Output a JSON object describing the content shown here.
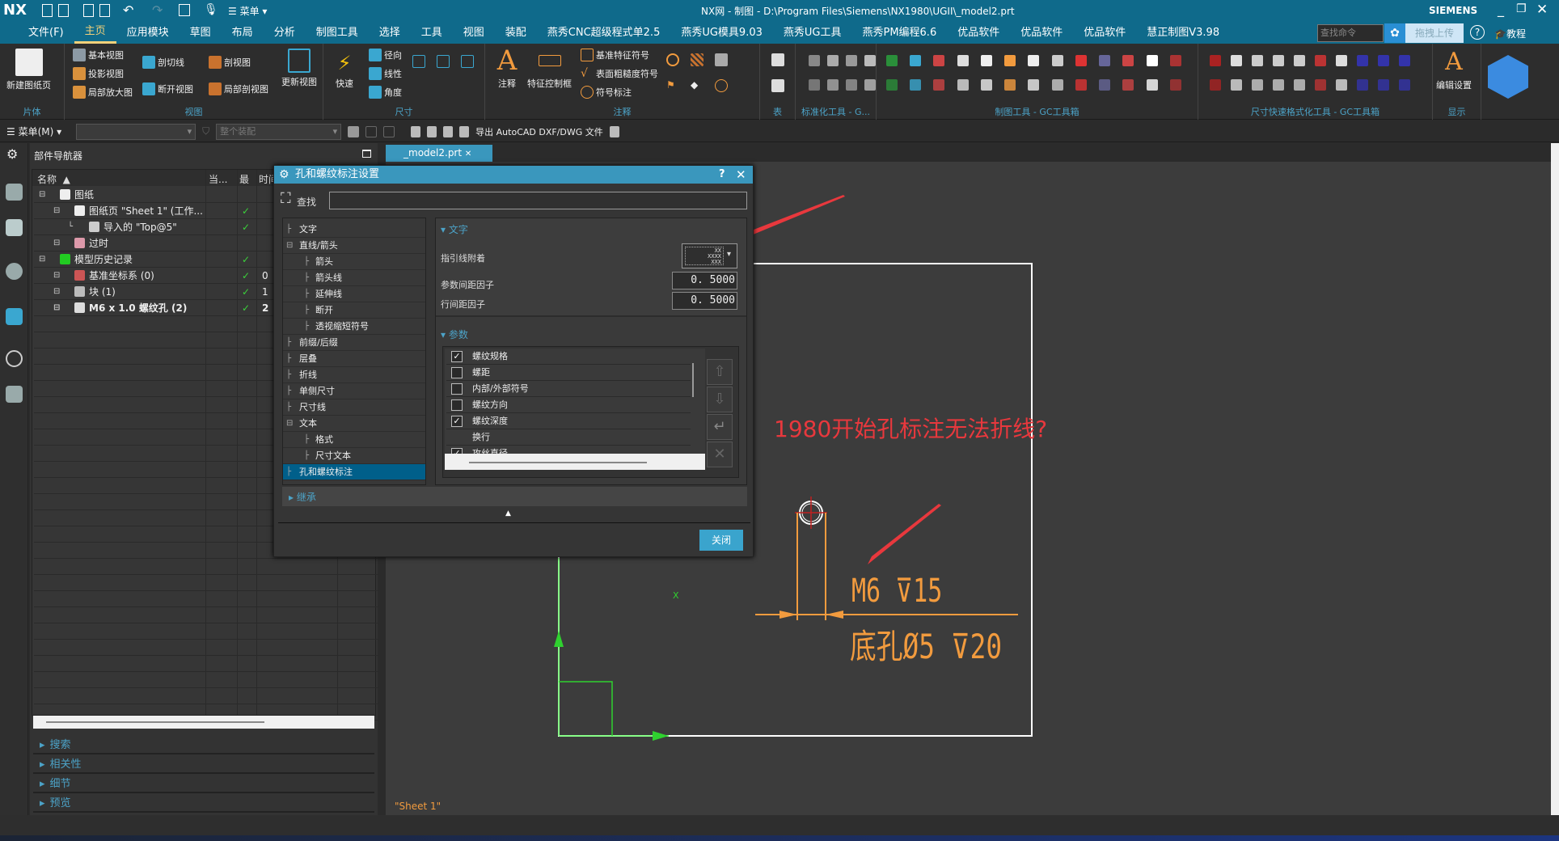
{
  "titlebar": {
    "logo": "NX",
    "quick_menu": "菜单",
    "title": "NX网 - 制图 - D:\\Program Files\\Siemens\\NX1980\\UGII\\_model2.prt",
    "brand": "SIEMENS"
  },
  "menubar": {
    "items": [
      "文件(F)",
      "主页",
      "应用模块",
      "草图",
      "布局",
      "分析",
      "制图工具",
      "选择",
      "工具",
      "视图",
      "装配",
      "燕秀CNC超级程式单2.5",
      "燕秀UG模具9.03",
      "燕秀UG工具",
      "燕秀PM编程6.6",
      "优品软件",
      "优品软件",
      "优品软件",
      "慧正制图V3.98"
    ],
    "active": "主页",
    "search_placeholder": "查找命令",
    "upload_label": "拖拽上传",
    "help_label": "?",
    "tutorial_label": "教程"
  },
  "ribbon": {
    "groups": [
      "片体",
      "视图",
      "尺寸",
      "注释",
      "表",
      "标准化工具 - G...",
      "制图工具 - GC工具箱",
      "尺寸快速格式化工具 - GC工具箱",
      "显示"
    ],
    "new_sheet": "新建图纸页",
    "view_items": [
      "基本视图",
      "投影视图",
      "局部放大图",
      "剖切线",
      "断开视图",
      "剖视图",
      "局部剖视图",
      "更新视图"
    ],
    "dim_items": [
      "快速",
      "径向",
      "线性",
      "角度"
    ],
    "note_items": [
      "注释",
      "特征控制框",
      "基准特征符号",
      "表面粗糙度符号",
      "符号标注"
    ],
    "edit_settings": "编辑设置"
  },
  "toolbar2": {
    "menu": "菜单(M)",
    "filter_value": "",
    "scope_value": "整个装配",
    "export_label": "导出 AutoCAD DXF/DWG 文件"
  },
  "navigator": {
    "title": "部件导航器",
    "columns": [
      "名称",
      "当...",
      "最",
      "时间"
    ],
    "rows": [
      {
        "label": "图纸",
        "level": 0,
        "check": false,
        "num": "",
        "icon": "drawing-icon",
        "bold": false
      },
      {
        "label": "图纸页 \"Sheet 1\" (工作...",
        "level": 1,
        "check": true,
        "num": "",
        "icon": "sheet-icon",
        "bold": false
      },
      {
        "label": "导入的 \"Top@5\"",
        "level": 2,
        "check": true,
        "num": "",
        "icon": "view-icon",
        "bold": false
      },
      {
        "label": "过时",
        "level": 1,
        "check": false,
        "num": "",
        "icon": "folder-icon",
        "bold": false
      },
      {
        "label": "模型历史记录",
        "level": 0,
        "check": true,
        "num": "",
        "icon": "history-icon",
        "bold": false
      },
      {
        "label": "基准坐标系 (0)",
        "level": 1,
        "check": true,
        "num": "0",
        "icon": "datum-csys-icon",
        "bold": false
      },
      {
        "label": "块 (1)",
        "level": 1,
        "check": true,
        "num": "1",
        "icon": "block-icon",
        "bold": false
      },
      {
        "label": "M6 x 1.0 螺纹孔 (2)",
        "level": 1,
        "check": true,
        "num": "2",
        "icon": "threaded-hole-icon",
        "bold": true
      }
    ],
    "sections": [
      "搜索",
      "相关性",
      "细节",
      "预览"
    ]
  },
  "tab": {
    "label": "_model2.prt"
  },
  "dialog": {
    "title": "孔和螺纹标注设置",
    "help": "?",
    "find_label": "查找",
    "find_value": "",
    "tree": [
      {
        "label": "文字",
        "level": 0
      },
      {
        "label": "直线/箭头",
        "level": 0,
        "expand": true
      },
      {
        "label": "箭头",
        "level": 1
      },
      {
        "label": "箭头线",
        "level": 1
      },
      {
        "label": "延伸线",
        "level": 1
      },
      {
        "label": "断开",
        "level": 1
      },
      {
        "label": "透视缩短符号",
        "level": 1
      },
      {
        "label": "前缀/后缀",
        "level": 0
      },
      {
        "label": "层叠",
        "level": 0
      },
      {
        "label": "折线",
        "level": 0
      },
      {
        "label": "单侧尺寸",
        "level": 0
      },
      {
        "label": "尺寸线",
        "level": 0
      },
      {
        "label": "文本",
        "level": 0,
        "expand": true
      },
      {
        "label": "格式",
        "level": 1
      },
      {
        "label": "尺寸文本",
        "level": 1
      },
      {
        "label": "孔和螺纹标注",
        "level": 0,
        "selected": true
      }
    ],
    "text_section": {
      "title": "文字",
      "leader_label": "指引线附着",
      "leader_preview": [
        "XX",
        "XXXX",
        "XXX"
      ],
      "param_spacing_label": "参数间距因子",
      "param_spacing": "0. 5000",
      "line_spacing_label": "行间距因子",
      "line_spacing": "0. 5000"
    },
    "params_section": {
      "title": "参数",
      "items": [
        {
          "label": "螺纹规格",
          "checked": true
        },
        {
          "label": "螺距",
          "checked": false
        },
        {
          "label": "内部/外部符号",
          "checked": false
        },
        {
          "label": "螺纹方向",
          "checked": false
        },
        {
          "label": "螺纹深度",
          "checked": true
        },
        {
          "label": "换行",
          "checked": null
        },
        {
          "label": "攻丝直径",
          "checked": true
        }
      ]
    },
    "inherit_label": "继承",
    "close_label": "关闭"
  },
  "drawing": {
    "annotation": "1980开始孔标注无法折线?",
    "callout_line1": "M6 ⊽15",
    "callout_line2": "底孔Ø5 ⊽20",
    "sheet_label": "\"Sheet 1\"",
    "axis_x": "X",
    "annotation_color": "#e8383d",
    "dim_color": "#f29b3e",
    "axis_color": "#2fd12f"
  }
}
